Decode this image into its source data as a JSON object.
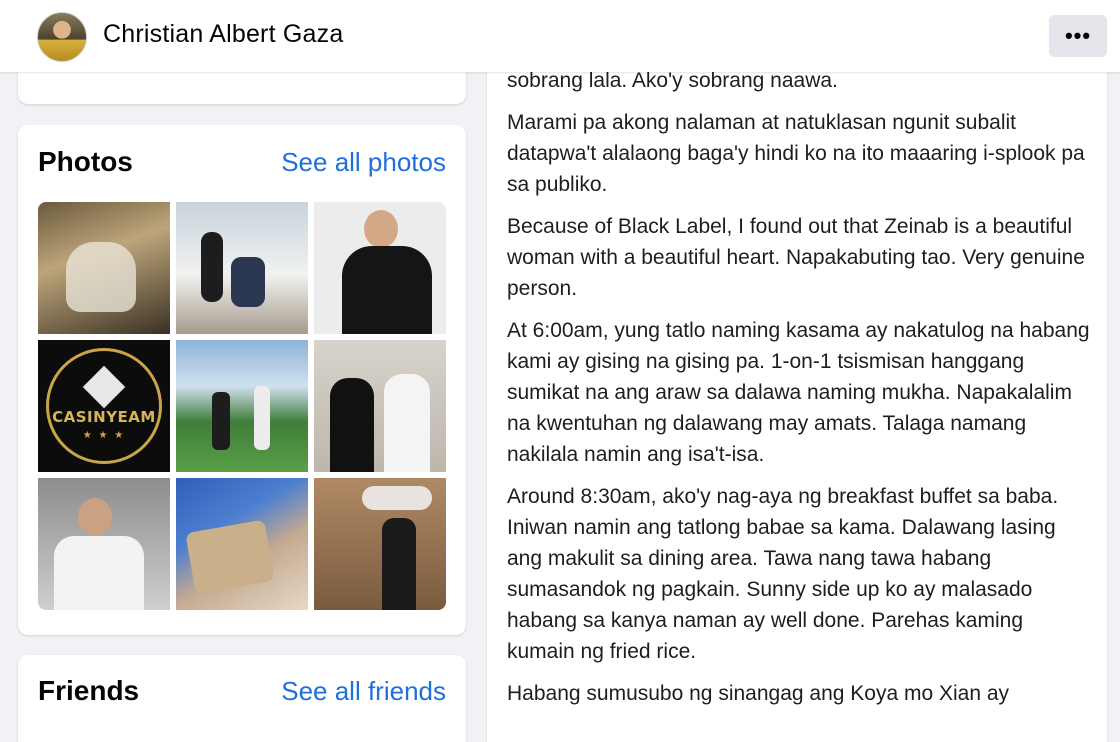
{
  "header": {
    "profile_name": "Christian Albert Gaza",
    "avatar_icon": "profile-avatar",
    "more_label": "•••"
  },
  "photos_card": {
    "title": "Photos",
    "see_all_label": "See all photos",
    "photos": [
      {
        "icon": "photo-airplane-cabin"
      },
      {
        "icon": "photo-couple-laptop"
      },
      {
        "icon": "photo-man-in-suit"
      },
      {
        "icon": "photo-casinyeam-logo",
        "logo_text": "CASINYEAM"
      },
      {
        "icon": "photo-two-men-garden"
      },
      {
        "icon": "photo-two-men-plants"
      },
      {
        "icon": "photo-man-hospital-bed"
      },
      {
        "icon": "photo-cash-bundle"
      },
      {
        "icon": "photo-group-store"
      }
    ]
  },
  "friends_card": {
    "title": "Friends",
    "see_all_label": "See all friends"
  },
  "post": {
    "paragraphs": [
      "years. Kung mariinig niyo lang ang bawat kwento, nako po, sobrang lala. Ako'y sobrang naawa.",
      "Marami pa akong nalaman at natuklasan ngunit subalit datapwa't alalaong baga'y hindi ko na ito maaaring i-splook pa sa publiko.",
      "Because of Black Label, I found out that Zeinab is a beautiful woman with a beautiful heart. Napakabuting tao. Very genuine person.",
      "At 6:00am, yung tatlo naming kasama ay nakatulog na habang kami ay gising na gising pa. 1-on-1 tsismisan hanggang sumikat na ang araw sa dalawa naming mukha. Napakalalim na kwentuhan ng dalawang may amats. Talaga namang nakilala namin ang isa't-isa.",
      "Around 8:30am, ako'y nag-aya ng breakfast buffet sa baba. Iniwan namin ang tatlong babae sa kama. Dalawang lasing ang makulit sa dining area. Tawa nang tawa habang sumasandok ng pagkain. Sunny side up ko ay malasado habang sa kanya naman ay well done. Parehas kaming kumain ng fried rice.",
      "Habang sumusubo ng sinangag ang Koya mo Xian ay"
    ]
  },
  "colors": {
    "link": "#216fdb",
    "page_background": "#f0f2f5",
    "card_background": "#ffffff"
  }
}
